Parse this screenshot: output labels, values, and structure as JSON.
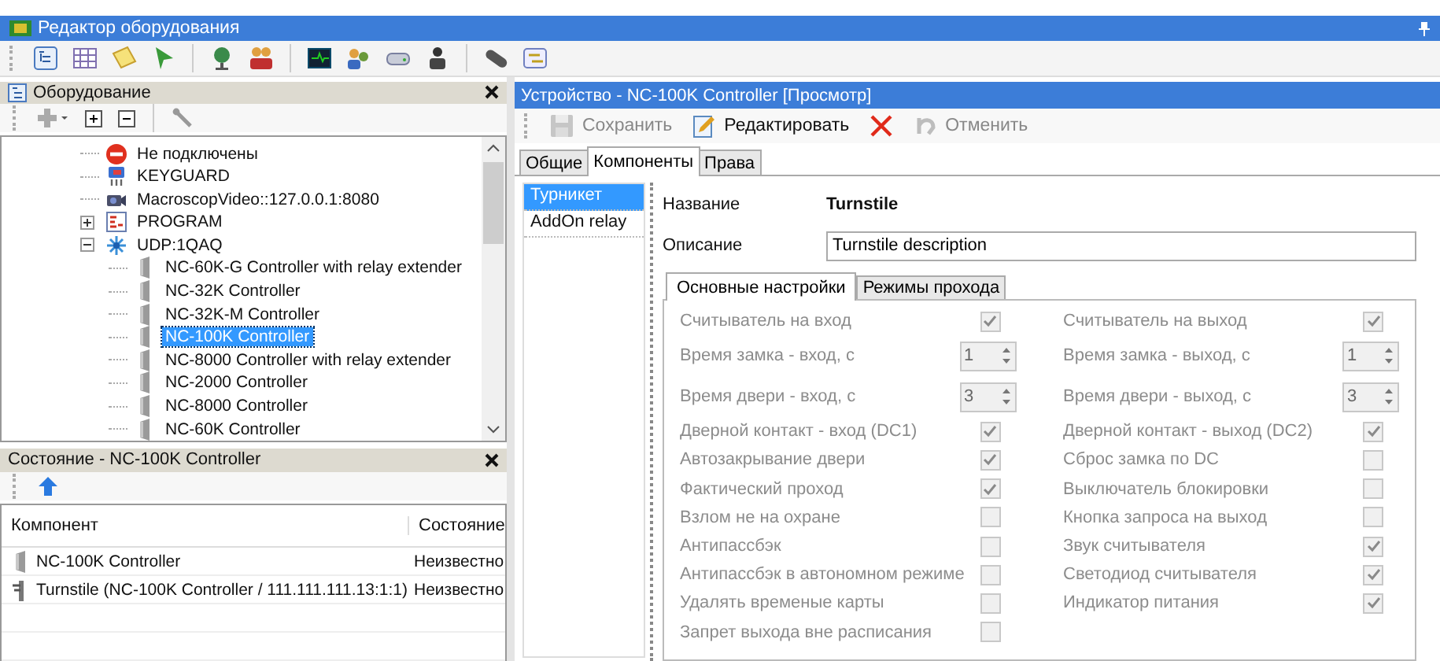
{
  "window": {
    "title": "Редактор оборудования"
  },
  "equipment_panel": {
    "title": "Оборудование",
    "tree": [
      {
        "kind": "error",
        "label": "Не подключены",
        "selected": false
      },
      {
        "kind": "keyguard",
        "label": "KEYGUARD",
        "selected": false
      },
      {
        "kind": "video",
        "label": "MacroscopVideo::127.0.0.1:8080",
        "selected": false
      },
      {
        "kind": "program",
        "label": "PROGRAM",
        "selected": false,
        "expanded": false
      },
      {
        "kind": "network",
        "label": "UDP:1QAQ",
        "selected": false,
        "expanded": true,
        "children": [
          {
            "kind": "controller",
            "label": "NC-60K-G Controller with relay extender",
            "selected": false
          },
          {
            "kind": "controller",
            "label": "NC-32K Controller",
            "selected": false
          },
          {
            "kind": "controller",
            "label": "NC-32K-M Controller",
            "selected": false
          },
          {
            "kind": "controller",
            "label": "NC-100K Controller",
            "selected": true
          },
          {
            "kind": "controller",
            "label": "NC-8000 Controller with relay extender",
            "selected": false
          },
          {
            "kind": "controller",
            "label": "NC-2000 Controller",
            "selected": false
          },
          {
            "kind": "controller",
            "label": "NC-8000 Controller",
            "selected": false
          },
          {
            "kind": "controller",
            "label": "NC-60K Controller",
            "selected": false
          }
        ]
      }
    ]
  },
  "state_panel": {
    "title": "Состояние - NC-100K Controller",
    "columns": [
      "Компонент",
      "Состояние"
    ],
    "rows": [
      {
        "kind": "controller",
        "cells": [
          "NC-100K Controller",
          "Неизвестно"
        ]
      },
      {
        "kind": "turnstile",
        "cells": [
          "Turnstile (NC-100K Controller / 111.111.111.13:1:1)",
          "Неизвестно"
        ]
      }
    ]
  },
  "device_panel": {
    "title": "Устройство - NC-100K Controller [Просмотр]",
    "toolbar": [
      {
        "kind": "save",
        "label": "Сохранить",
        "disabled": true
      },
      {
        "kind": "edit",
        "label": "Редактировать",
        "disabled": false
      },
      {
        "kind": "delete",
        "disabled": false
      },
      {
        "kind": "undo",
        "label": "Отменить",
        "disabled": true
      }
    ],
    "tabs": [
      {
        "label": "Общие",
        "selected": false
      },
      {
        "label": "Компоненты",
        "selected": true
      },
      {
        "label": "Права",
        "selected": false
      }
    ],
    "components": [
      {
        "label": "Турникет",
        "selected": true
      },
      {
        "label": "AddOn relay",
        "selected": false
      }
    ],
    "name_label": "Название",
    "name_value": "Turnstile",
    "description_label": "Описание",
    "description_value": "Turnstile description",
    "settings_tabs": [
      {
        "label": "Основные настройки",
        "selected": true
      },
      {
        "label": "Режимы прохода",
        "selected": false
      }
    ],
    "settings_left": [
      {
        "kind": "checkbox",
        "label": "Считыватель на вход",
        "checked": true,
        "disabled": true
      },
      {
        "kind": "spinner",
        "label": "Время замка - вход, с",
        "value": "1",
        "disabled": true
      },
      {
        "kind": "spinner",
        "label": "Время двери - вход, с",
        "value": "3",
        "disabled": true
      },
      {
        "kind": "checkbox",
        "label": "Дверной контакт - вход (DC1)",
        "checked": true,
        "disabled": true
      },
      {
        "kind": "checkbox",
        "label": "Автозакрывание двери",
        "checked": true,
        "disabled": true
      },
      {
        "kind": "checkbox",
        "label": "Фактический проход",
        "checked": true,
        "disabled": true
      },
      {
        "kind": "checkbox",
        "label": "Взлом не на охране",
        "checked": false,
        "disabled": true
      },
      {
        "kind": "checkbox",
        "label": "Антипассбэк",
        "checked": false,
        "disabled": true
      },
      {
        "kind": "checkbox",
        "label": "Антипассбэк в автономном режиме",
        "checked": false,
        "disabled": true
      },
      {
        "kind": "checkbox",
        "label": "Удалять временые карты",
        "checked": false,
        "disabled": true
      },
      {
        "kind": "checkbox",
        "label": "Запрет выхода вне расписания",
        "checked": false,
        "disabled": true
      }
    ],
    "settings_right": [
      {
        "kind": "checkbox",
        "label": "Считыватель на выход",
        "checked": true,
        "disabled": true
      },
      {
        "kind": "spinner",
        "label": "Время замка - выход, с",
        "value": "1",
        "disabled": true
      },
      {
        "kind": "spinner",
        "label": "Время двери - выход, с",
        "value": "3",
        "disabled": true
      },
      {
        "kind": "checkbox",
        "label": "Дверной контакт - выход (DC2)",
        "checked": true,
        "disabled": true
      },
      {
        "kind": "checkbox",
        "label": "Сброс замка по DC",
        "checked": false,
        "disabled": true
      },
      {
        "kind": "checkbox",
        "label": "Выключатель блокировки",
        "checked": false,
        "disabled": true
      },
      {
        "kind": "checkbox",
        "label": "Кнопка запроса на выход",
        "checked": false,
        "disabled": true
      },
      {
        "kind": "checkbox",
        "label": "Звук считывателя",
        "checked": true,
        "disabled": true
      },
      {
        "kind": "checkbox",
        "label": "Светодиод считывателя",
        "checked": true,
        "disabled": true
      },
      {
        "kind": "checkbox",
        "label": "Индикатор питания",
        "checked": true,
        "disabled": true
      }
    ]
  }
}
